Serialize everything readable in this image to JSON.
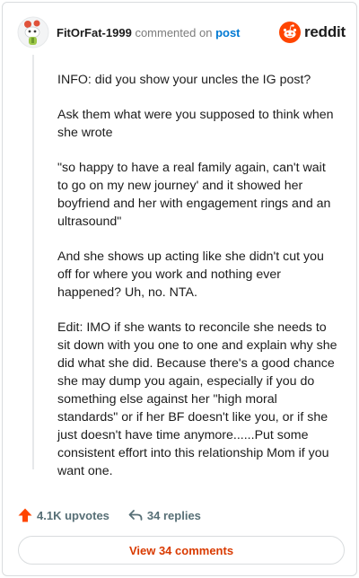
{
  "comment": {
    "username": "FitOrFat-1999",
    "commented_on_text": "commented on",
    "post_link_text": "post",
    "paragraphs": [
      "INFO: did you show your uncles the IG post?",
      "Ask them what were you supposed to think when she wrote",
      "\"so happy to have a real family again, can't wait to go on my new journey' and it showed her boyfriend and her with engagement rings and an ultrasound\"",
      "And she shows up acting like she didn't cut you off for where you work and nothing ever happened? Uh, no. NTA.",
      "Edit: IMO if she wants to reconcile she needs to sit down with you one to one and explain why she did what she did. Because there's a good chance she may dump you again, especially if you do something else against her \"high moral standards\" or if her BF doesn't like you, or if she just doesn't have time anymore......Put some consistent effort into this relationship Mom if you want one."
    ]
  },
  "brand": {
    "name": "reddit",
    "color": "#ff4500"
  },
  "actions": {
    "upvotes": "4.1K upvotes",
    "replies": "34 replies"
  },
  "view_comments_label": "View 34 comments",
  "icons": {
    "avatar": "snoo-avatar-icon",
    "logo": "reddit-logo-icon",
    "upvote": "upvote-arrow-icon",
    "reply": "reply-arrow-icon"
  },
  "colors": {
    "upvote": "#ff4500",
    "link": "#0079d3",
    "view_button_text": "#d93a00"
  }
}
